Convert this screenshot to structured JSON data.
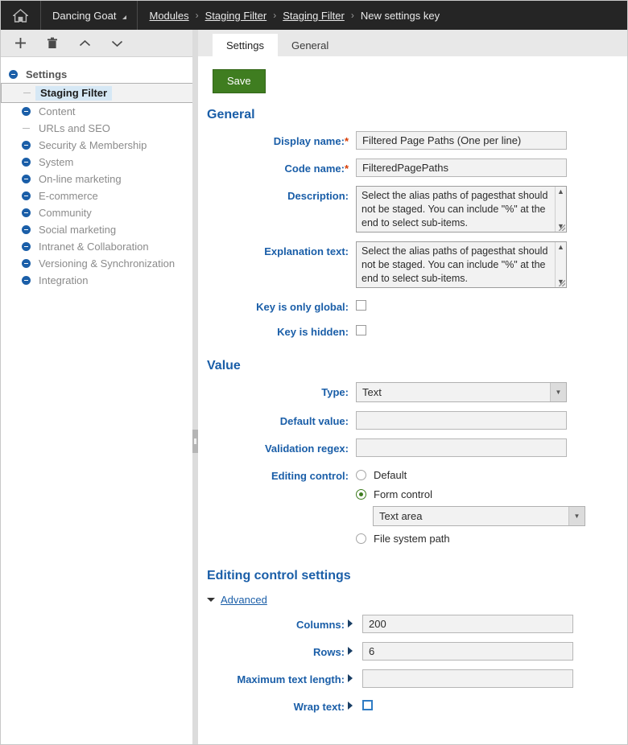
{
  "header": {
    "home_icon": "home-icon",
    "site_name": "Dancing Goat",
    "breadcrumb": [
      {
        "label": "Modules",
        "link": true
      },
      {
        "label": "Staging Filter",
        "link": true
      },
      {
        "label": "Staging Filter",
        "link": true
      },
      {
        "label": "New settings key",
        "link": false
      }
    ],
    "separator": "›"
  },
  "sidebar": {
    "toolbar": [
      {
        "name": "add-button",
        "glyph": "+"
      },
      {
        "name": "delete-button",
        "glyph": "trash"
      },
      {
        "name": "move-up-button",
        "glyph": "chevron-up"
      },
      {
        "name": "move-down-button",
        "glyph": "chevron-down"
      }
    ],
    "tree": [
      {
        "label": "Settings",
        "type": "root",
        "expandable": true,
        "selected": false
      },
      {
        "label": "Staging Filter",
        "type": "leaf",
        "expandable": false,
        "selected": true
      },
      {
        "label": "Content",
        "type": "node",
        "expandable": true,
        "selected": false
      },
      {
        "label": "URLs and SEO",
        "type": "leaf",
        "expandable": false,
        "selected": false
      },
      {
        "label": "Security & Membership",
        "type": "node",
        "expandable": true,
        "selected": false
      },
      {
        "label": "System",
        "type": "node",
        "expandable": true,
        "selected": false
      },
      {
        "label": "On-line marketing",
        "type": "node",
        "expandable": true,
        "selected": false
      },
      {
        "label": "E-commerce",
        "type": "node",
        "expandable": true,
        "selected": false
      },
      {
        "label": "Community",
        "type": "node",
        "expandable": true,
        "selected": false
      },
      {
        "label": "Social marketing",
        "type": "node",
        "expandable": true,
        "selected": false
      },
      {
        "label": "Intranet & Collaboration",
        "type": "node",
        "expandable": true,
        "selected": false
      },
      {
        "label": "Versioning & Synchronization",
        "type": "node",
        "expandable": true,
        "selected": false
      },
      {
        "label": "Integration",
        "type": "node",
        "expandable": true,
        "selected": false
      }
    ]
  },
  "tabs": [
    {
      "label": "Settings",
      "active": true
    },
    {
      "label": "General",
      "active": false
    }
  ],
  "toolbar": {
    "save_label": "Save"
  },
  "sections": {
    "general": {
      "title": "General",
      "display_name": {
        "label": "Display name:",
        "required": "*",
        "value": "Filtered Page Paths (One per line)"
      },
      "code_name": {
        "label": "Code name:",
        "required": "*",
        "value": "FilteredPagePaths"
      },
      "description": {
        "label": "Description:",
        "value": "Select the alias paths of pagesthat should not be staged. You can include \"%\" at the end to select sub-items."
      },
      "explanation_text": {
        "label": "Explanation text:",
        "value": "Select the alias paths of pagesthat should not be staged. You can include \"%\" at the end to select sub-items."
      },
      "key_is_only_global": {
        "label": "Key is only global:",
        "checked": false
      },
      "key_is_hidden": {
        "label": "Key is hidden:",
        "checked": false
      }
    },
    "value": {
      "title": "Value",
      "type": {
        "label": "Type:",
        "value": "Text"
      },
      "default_value": {
        "label": "Default value:",
        "value": ""
      },
      "validation_regex": {
        "label": "Validation regex:",
        "value": ""
      },
      "editing_control": {
        "label": "Editing control:",
        "options": [
          {
            "label": "Default",
            "selected": false
          },
          {
            "label": "Form control",
            "selected": true
          },
          {
            "label": "File system path",
            "selected": false
          }
        ],
        "form_control_value": "Text area"
      }
    },
    "editing_control_settings": {
      "title": "Editing control settings",
      "advanced_label": "Advanced",
      "columns": {
        "label": "Columns:",
        "value": "200"
      },
      "rows": {
        "label": "Rows:",
        "value": "6"
      },
      "maximum_text_length": {
        "label": "Maximum text length:",
        "value": ""
      },
      "wrap_text": {
        "label": "Wrap text:",
        "checked": false
      }
    }
  },
  "colors": {
    "accent_blue": "#1a5ea8",
    "save_green": "#3f7d20",
    "required_red": "#d83b01",
    "topbar_bg": "#252525",
    "selection_bg": "#d6e8f5"
  }
}
